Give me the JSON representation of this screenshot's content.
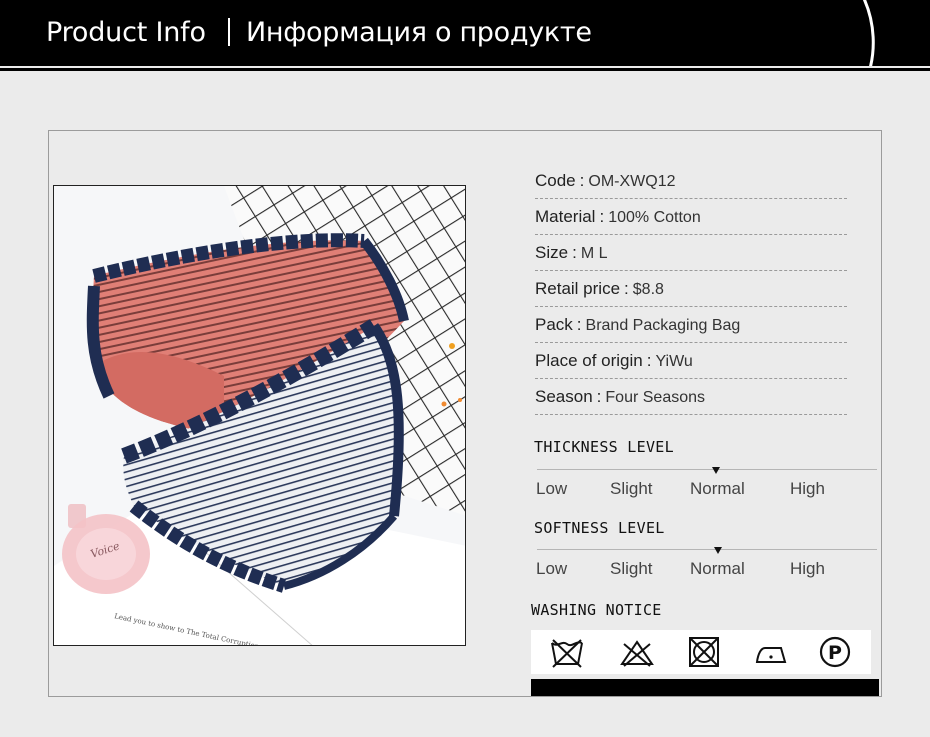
{
  "header": {
    "title_en": "Product Info",
    "title_ru": "Информация о продукте"
  },
  "photo": {
    "alt": "Two striped briefs with navy lace trim (coral and grey) on white background with grid and perfume bottle",
    "perfume_label": "Voice",
    "paper_text": "Lead you to show to The Total Corruption"
  },
  "specs": [
    {
      "label": "Code",
      "sep": ":",
      "value": "OM-XWQ12"
    },
    {
      "label": "Material",
      "sep": ":",
      "value": "100% Cotton"
    },
    {
      "label": "Size",
      "sep": ":",
      "value": "M L"
    },
    {
      "label": "Retail price",
      "sep": ":",
      "value": "$8.8"
    },
    {
      "label": "Pack",
      "sep": ":",
      "value": "Brand Packaging Bag"
    },
    {
      "label": "Place of origin",
      "sep": ":",
      "value": "YiWu"
    },
    {
      "label": "Season",
      "sep": ":",
      "value": "Four Seasons"
    }
  ],
  "thickness": {
    "title": "THICKNESS LEVEL",
    "options": [
      "Low",
      "Slight",
      "Normal",
      "High"
    ],
    "selected": "Normal"
  },
  "softness": {
    "title": "SOFTNESS LEVEL",
    "options": [
      "Low",
      "Slight",
      "Normal",
      "High"
    ],
    "selected": "Normal"
  },
  "washing": {
    "title": "WASHING NOTICE",
    "icons": [
      "no-wash-icon",
      "no-bleach-icon",
      "no-tumble-dry-icon",
      "iron-low-icon",
      "dry-clean-p-icon"
    ]
  },
  "colors": {
    "header_bg": "#000000",
    "page_bg": "#ebebeb",
    "coral": "#d9776f",
    "navy_lace": "#1f2d52"
  }
}
